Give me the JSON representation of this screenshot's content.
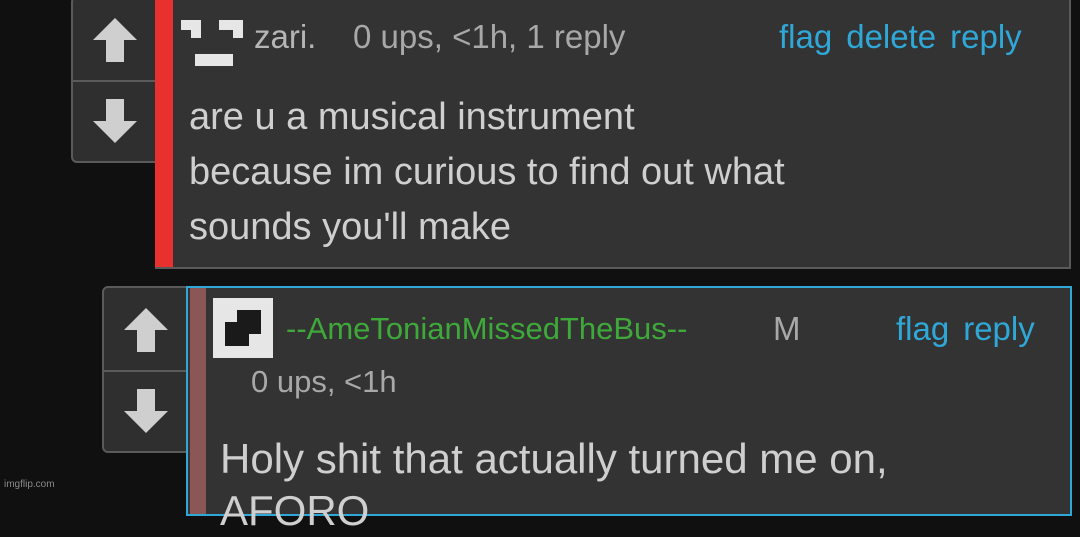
{
  "comment1": {
    "username": "zari.",
    "meta": "0 ups, <1h, 1 reply",
    "actions": {
      "flag": "flag",
      "delete": "delete",
      "reply": "reply"
    },
    "lines": [
      "are u a musical instrument",
      "because im curious to find out what",
      "sounds you'll make"
    ],
    "stripe_color": "#e8302f"
  },
  "comment2": {
    "username": "--AmeTonianMissedTheBus--",
    "mod_badge": "M",
    "meta": "0 ups, <1h",
    "actions": {
      "flag": "flag",
      "reply": "reply"
    },
    "lines": [
      "Holy shit that actually turned me on,",
      "AFORO"
    ],
    "border_color": "#2fa8d8",
    "username_color": "#3fa83a"
  },
  "watermark": "imgflip.com",
  "icons": [
    "upvote-arrow-icon",
    "downvote-arrow-icon",
    "user-avatar-icon"
  ]
}
